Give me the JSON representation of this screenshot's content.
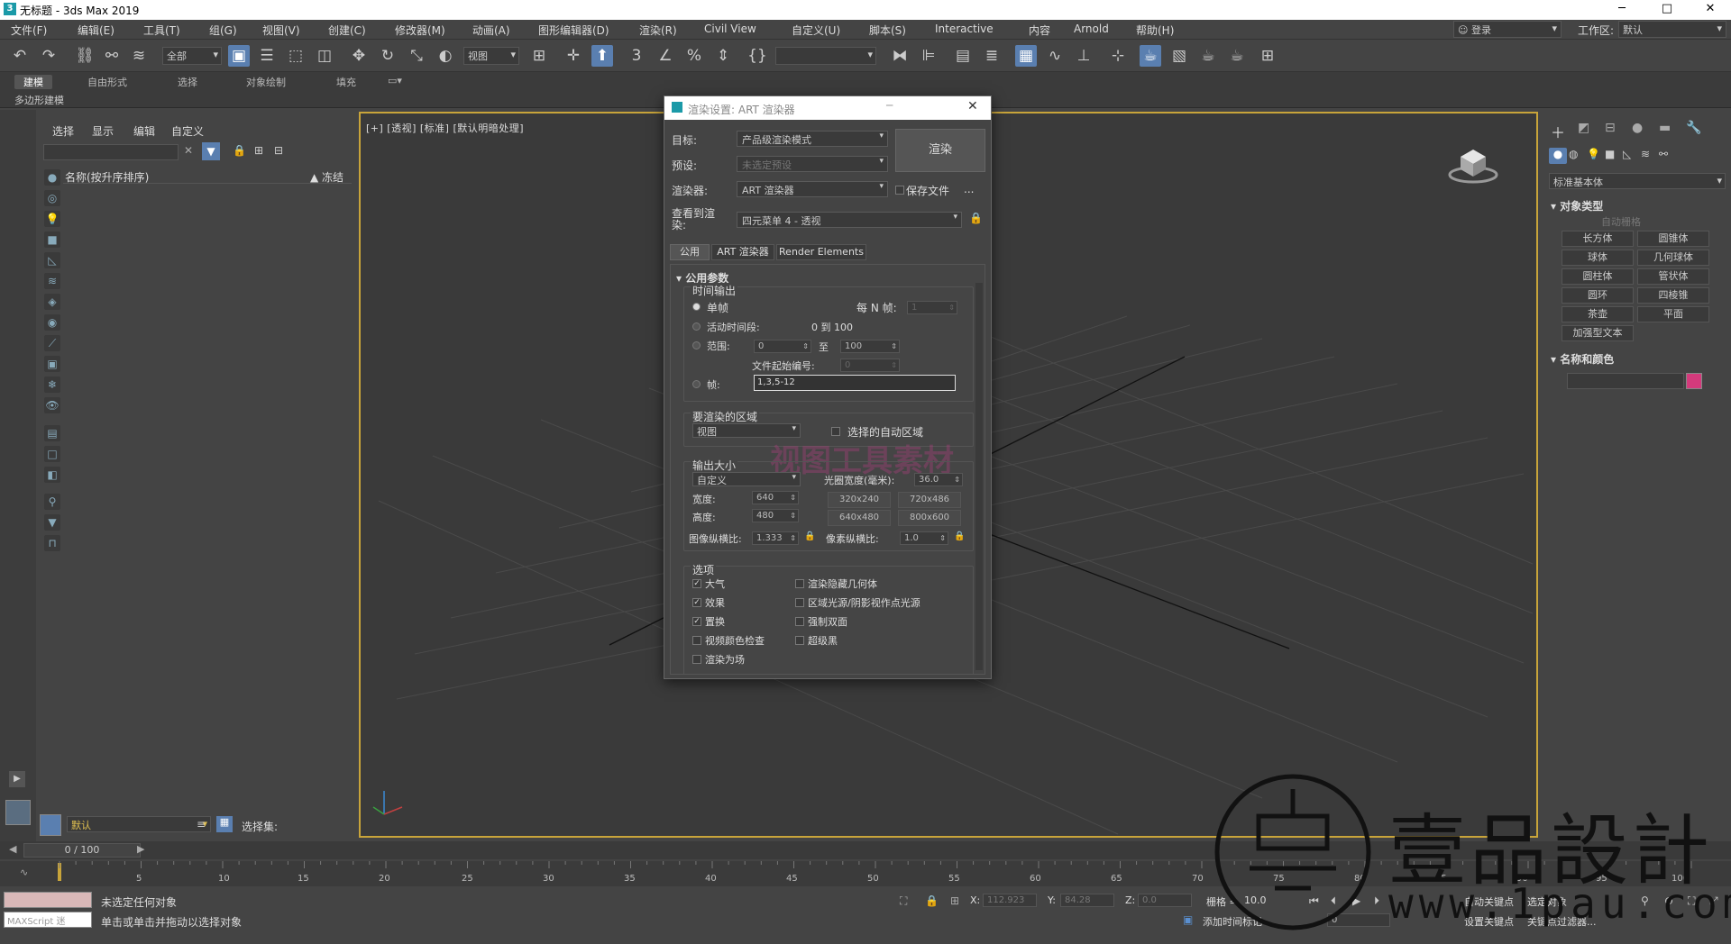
{
  "window": {
    "title": "无标题 - 3ds Max 2019",
    "min": "─",
    "max": "□",
    "close": "✕"
  },
  "menu": [
    "文件(F)",
    "编辑(E)",
    "工具(T)",
    "组(G)",
    "视图(V)",
    "创建(C)",
    "修改器(M)",
    "动画(A)",
    "图形编辑器(D)",
    "渲染(R)",
    "Civil View",
    "自定义(U)",
    "脚本(S)",
    "Interactive",
    "内容",
    "Arnold",
    "帮助(H)"
  ],
  "login": {
    "label": "登录"
  },
  "workspace": {
    "label": "工作区:",
    "value": "默认"
  },
  "toolbar": {
    "filter": "全部",
    "view": "视图"
  },
  "ribbon": {
    "tabs": [
      "建模",
      "自由形式",
      "选择",
      "对象绘制",
      "填充"
    ],
    "sub": "多边形建模"
  },
  "explorer": {
    "tabs": [
      "选择",
      "显示",
      "编辑",
      "自定义"
    ],
    "col_name": "名称(按升序排序)",
    "col_freeze": "▲ 冻结",
    "layer": "默认",
    "selset": "选择集:"
  },
  "viewport": {
    "label": "[+] [透视] [标准] [默认明暗处理]"
  },
  "dialog": {
    "title": "渲染设置: ART 渲染器",
    "target_label": "目标:",
    "target_value": "产品级渲染模式",
    "preset_label": "预设:",
    "preset_value": "未选定预设",
    "renderer_label": "渲染器:",
    "renderer_value": "ART 渲染器",
    "savefile": "保存文件",
    "ellipsis": "...",
    "render_button": "渲染",
    "view_label": "查看到渲染:",
    "view_value": "四元菜单 4 - 透视",
    "tabs": [
      "公用",
      "ART 渲染器",
      "Render Elements"
    ],
    "section": "公用参数",
    "time_output": "时间输出",
    "single": "单帧",
    "every_n": "每 N 帧:",
    "every_n_val": "1",
    "active_seg": "活动时间段:",
    "active_range": "0 到 100",
    "range": "范围:",
    "range_from": "0",
    "range_to_label": "至",
    "range_to": "100",
    "file_start": "文件起始编号:",
    "file_start_val": "0",
    "frames": "帧:",
    "frames_val": "1,3,5-12",
    "area_title": "要渲染的区域",
    "area_value": "视图",
    "auto_region": "选择的自动区域",
    "output_title": "输出大小",
    "output_value": "自定义",
    "aperture": "光圈宽度(毫米):",
    "aperture_val": "36.0",
    "width_label": "宽度:",
    "width_val": "640",
    "height_label": "高度:",
    "height_val": "480",
    "presets": [
      "320x240",
      "720x486",
      "640x480",
      "800x600"
    ],
    "img_aspect": "图像纵横比:",
    "img_aspect_val": "1.333",
    "pix_aspect": "像素纵横比:",
    "pix_aspect_val": "1.0",
    "options_title": "选项",
    "opts_left": [
      "大气",
      "效果",
      "置换",
      "视频颜色检查",
      "渲染为场"
    ],
    "opts_right": [
      "渲染隐藏几何体",
      "区域光源/阴影视作点光源",
      "强制双面",
      "超级黑"
    ],
    "watermark": "视图工具素材"
  },
  "cmdpanel": {
    "dropdown": "标准基本体",
    "rollout1": "对象类型",
    "autogrid": "自动栅格",
    "buttons": [
      "长方体",
      "圆锥体",
      "球体",
      "几何球体",
      "圆柱体",
      "管状体",
      "圆环",
      "四棱锥",
      "茶壶",
      "平面",
      "加强型文本"
    ],
    "rollout2": "名称和颜色",
    "swatch": "#d43a7c"
  },
  "timeline": {
    "frame": "0 / 100",
    "ticks": [
      "5",
      "10",
      "15",
      "20",
      "25",
      "30",
      "35",
      "40",
      "45",
      "50",
      "55",
      "60",
      "65",
      "70",
      "75",
      "80",
      "85",
      "90",
      "95",
      "100"
    ]
  },
  "status": {
    "line1": "未选定任何对象",
    "line2": "单击或单击并拖动以选择对象",
    "maxscript": "MAXScript 迷",
    "x_label": "X:",
    "x_val": "112.923",
    "y_label": "Y:",
    "y_val": "84.28",
    "z_label": "Z:",
    "z_val": "0.0",
    "grid_label": "栅格 =",
    "grid_val": "10.0",
    "addtime": "添加时间标记",
    "autokey": "自动关键点",
    "setkey": "设置关键点",
    "selobj": "选定对象",
    "keyfilter": "关键点过滤器...",
    "frame_field": "0"
  },
  "logo": {
    "text": "壹品設計",
    "url": "www.1pau.com"
  }
}
